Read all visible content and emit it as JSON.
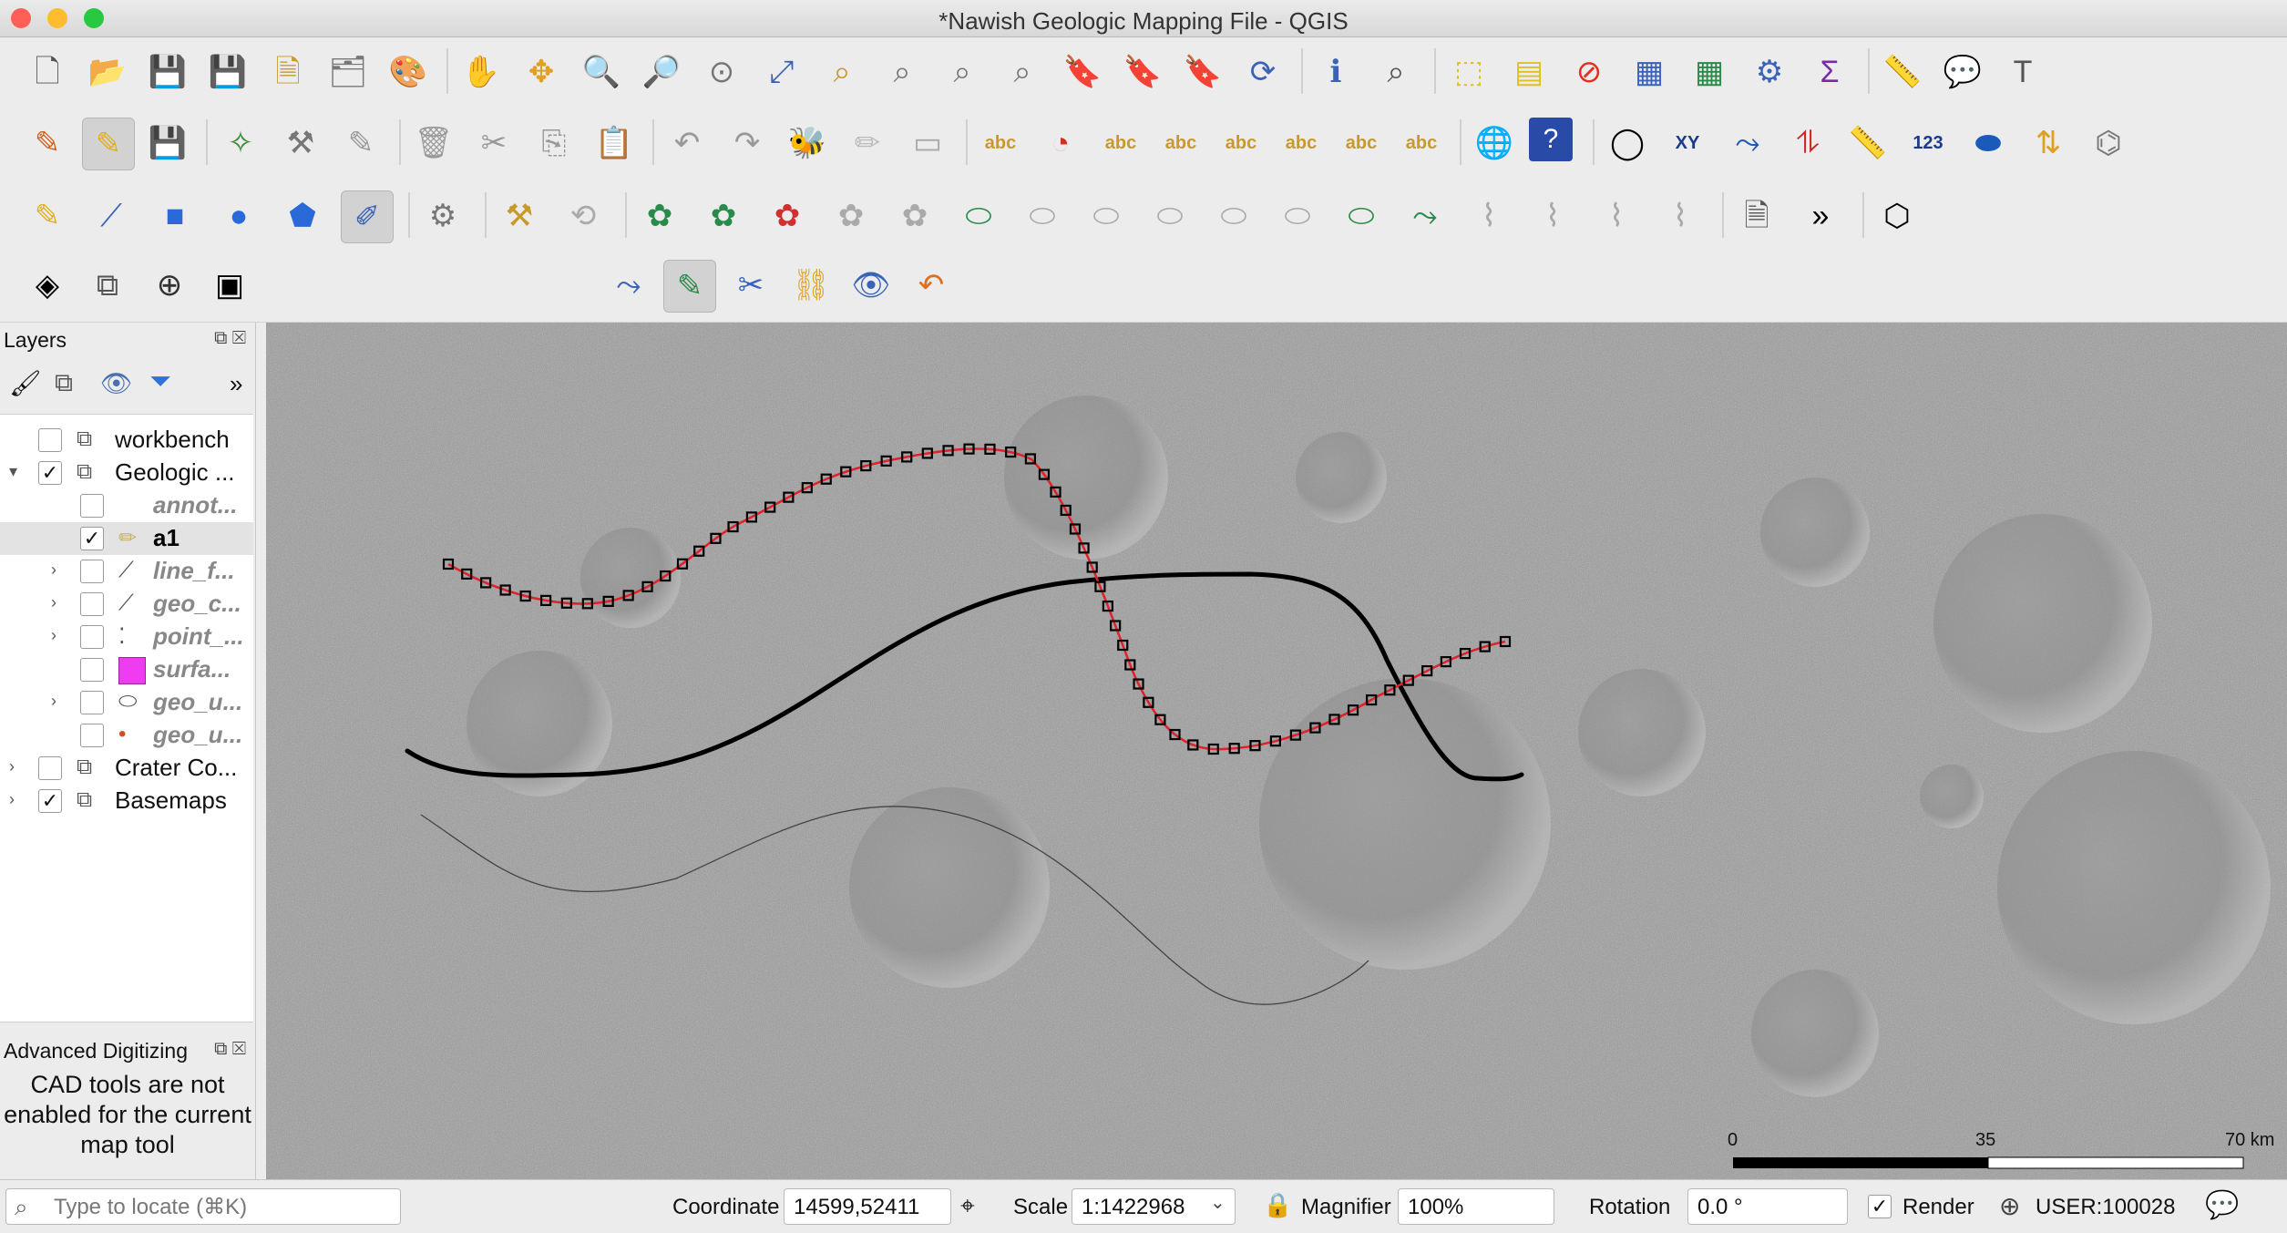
{
  "window": {
    "title": "*Nawish Geologic Mapping File - QGIS"
  },
  "colors": {
    "close": "#ff5f57",
    "minimize": "#febc2e",
    "zoom": "#28c840",
    "active_line": "#000000",
    "edit_line": "#e0202a",
    "surface_swatch": "#f03cf0"
  },
  "toolbar1": [
    "new-project-icon",
    "open-project-icon",
    "save-project-icon",
    "save-as-icon",
    "new-print-layout-icon",
    "layout-manager-icon",
    "style-manager-icon",
    "pan-icon",
    "pan-to-selection-icon",
    "zoom-in-icon",
    "zoom-out-icon",
    "zoom-native-icon",
    "zoom-full-icon",
    "zoom-to-selection-icon",
    "zoom-to-layer-icon",
    "zoom-last-icon",
    "zoom-next-icon",
    "new-bookmark-icon",
    "show-bookmarks-icon",
    "show-spatial-bookmarks-icon",
    "refresh-icon",
    "identify-icon",
    "map-tips-icon",
    "select-features-icon",
    "select-by-value-icon",
    "deselect-icon",
    "attribute-table-icon",
    "field-calculator-icon",
    "toolbox-icon",
    "statistics-icon",
    "measure-icon",
    "annotation-icon",
    "text-annotation-icon"
  ],
  "toolbar2": [
    "current-edits-icon",
    "toggle-editing-icon",
    "save-edits-icon",
    "digitize-icon",
    "vertex-tool-icon",
    "modify-attributes-icon",
    "delete-icon",
    "cut-icon",
    "copy-icon",
    "paste-icon",
    "undo-icon",
    "redo-icon",
    "digitize-shape-icon",
    "pencil-icon",
    "eraser-icon",
    "label-icon",
    "diagram-icon",
    "label-pin-icon",
    "label-highlight-icon",
    "label-show-icon",
    "label-move-icon",
    "label-rotate-icon",
    "label-change-icon",
    "globe-icon",
    "help-icon",
    "ring-icon",
    "xy-icon",
    "snap-icon",
    "topology-icon",
    "measure-line-icon",
    "number-icon",
    "shape-icon",
    "sort-icon",
    "network-icon"
  ],
  "toolbar3": [
    "digitize-curve-icon",
    "trace-icon",
    "rectangle-icon",
    "circle-icon",
    "regular-polygon-icon",
    "freehand-icon",
    "settings-icon",
    "hammer-icon",
    "rotate-icon",
    "add-ring-icon",
    "add-part-icon",
    "fill-ring-icon",
    "delete-ring-icon",
    "delete-part-icon",
    "reshape-icon",
    "offset-curve-icon",
    "reverse-line-icon",
    "split-features-icon",
    "split-parts-icon",
    "merge-features-icon",
    "merge-attributes-icon",
    "rotate-point-icon",
    "create-icon",
    "create-d-icon",
    "create-f-icon",
    "disabled-icon",
    "print-layout-icon",
    "more-icon",
    "3d-icon"
  ],
  "toolbar4": [
    "layers-icon",
    "layer-stack-icon",
    "add-icon",
    "archive-icon",
    "node-edit-icon",
    "active-digitize-icon",
    "scissors-icon",
    "link-icon",
    "visibility-icon",
    "undo-orange-icon"
  ],
  "layers_panel": {
    "title": "Layers",
    "more": "»",
    "items": [
      {
        "label": "workbench",
        "checked": false,
        "indent": 0,
        "expander": "",
        "icon": "stack-icon",
        "style": "normal"
      },
      {
        "label": "Geologic ...",
        "checked": true,
        "indent": 0,
        "expander": "▾",
        "icon": "stack-icon",
        "style": "normal"
      },
      {
        "label": "annot...",
        "checked": false,
        "indent": 1,
        "expander": "",
        "icon": "",
        "style": "italic"
      },
      {
        "label": "a1",
        "checked": true,
        "indent": 1,
        "expander": "",
        "icon": "pencil-icon",
        "style": "bold"
      },
      {
        "label": "line_f...",
        "checked": false,
        "indent": 1,
        "expander": "›",
        "icon": "line-layer-icon",
        "style": "italic"
      },
      {
        "label": "geo_c...",
        "checked": false,
        "indent": 1,
        "expander": "›",
        "icon": "line-layer-icon",
        "style": "italic"
      },
      {
        "label": "point_...",
        "checked": false,
        "indent": 1,
        "expander": "›",
        "icon": "point-layer-icon",
        "style": "italic"
      },
      {
        "label": "surfa...",
        "checked": false,
        "indent": 1,
        "expander": "",
        "icon": "swatch-icon",
        "style": "italic"
      },
      {
        "label": "geo_u...",
        "checked": false,
        "indent": 1,
        "expander": "›",
        "icon": "polygon-layer-icon",
        "style": "italic"
      },
      {
        "label": "geo_u...",
        "checked": false,
        "indent": 1,
        "expander": "",
        "icon": "dot-icon",
        "style": "italic"
      },
      {
        "label": "Crater Co...",
        "checked": false,
        "indent": 0,
        "expander": "›",
        "icon": "stack-icon",
        "style": "normal"
      },
      {
        "label": "Basemaps",
        "checked": true,
        "indent": 0,
        "expander": "›",
        "icon": "stack-icon",
        "style": "normal"
      }
    ]
  },
  "advanced_digitizing": {
    "title": "Advanced Digitizing",
    "message_line1": "CAD tools are not",
    "message_line2": "enabled for the current",
    "message_line3": "map tool"
  },
  "map": {
    "scalebar": {
      "labels": [
        "0",
        "35",
        "70 km"
      ]
    }
  },
  "statusbar": {
    "locator_placeholder": "Type to locate (⌘K)",
    "coordinate_label": "Coordinate",
    "coordinate_value": "14599,52411",
    "scale_label": "Scale",
    "scale_value": "1:1422968",
    "magnifier_label": "Magnifier",
    "magnifier_value": "100%",
    "rotation_label": "Rotation",
    "rotation_value": "0.0 °",
    "render_label": "Render",
    "render_checked": true,
    "crs": "USER:100028"
  }
}
